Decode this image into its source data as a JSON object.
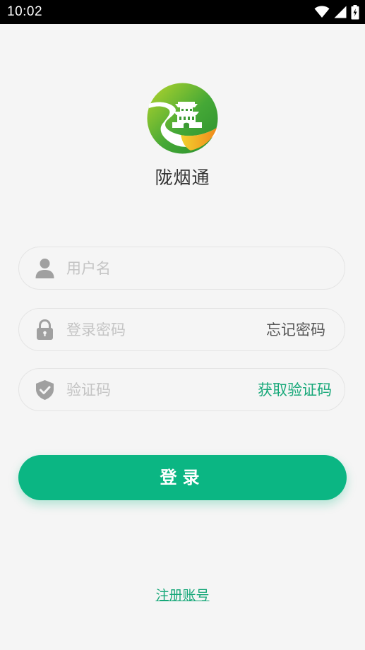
{
  "status_bar": {
    "time": "10:02",
    "icons": [
      "wifi-icon",
      "signal-icon",
      "battery-icon"
    ]
  },
  "app": {
    "title": "陇烟通"
  },
  "form": {
    "username": {
      "placeholder": "用户名",
      "value": "",
      "icon": "user-icon"
    },
    "password": {
      "placeholder": "登录密码",
      "value": "",
      "icon": "lock-icon",
      "forgot_label": "忘记密码"
    },
    "code": {
      "placeholder": "验证码",
      "value": "",
      "icon": "shield-check-icon",
      "get_code_label": "获取验证码"
    }
  },
  "login_button": {
    "label": "登录"
  },
  "register_link": {
    "label": "注册账号"
  },
  "colors": {
    "accent": "#0bb683",
    "link_green": "#17a879",
    "background": "#f5f5f5",
    "icon_gray": "#a0a0a0"
  }
}
